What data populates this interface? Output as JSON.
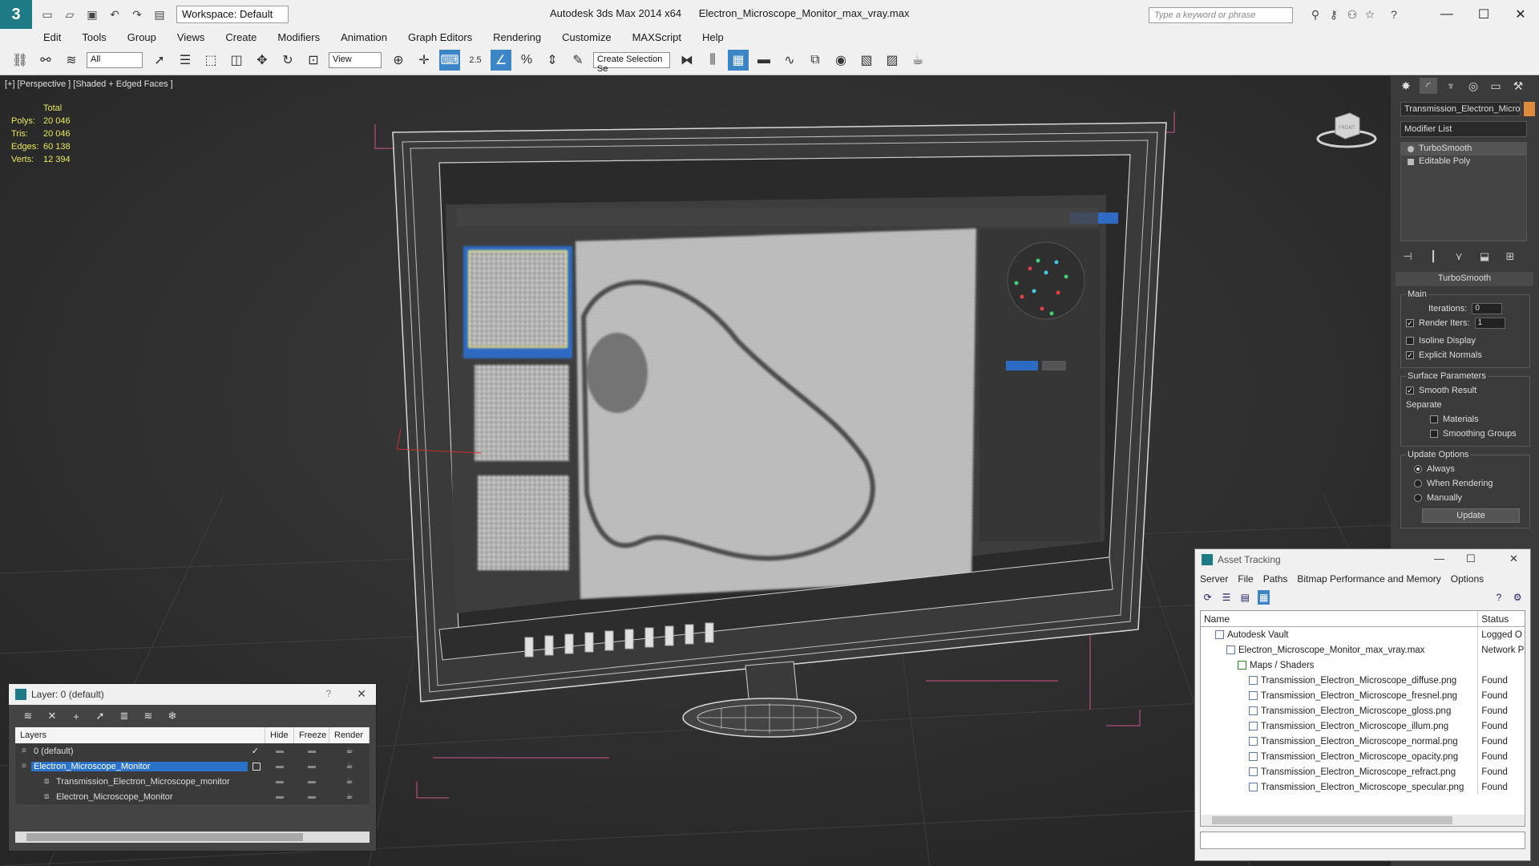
{
  "title_bar": {
    "workspace": "Workspace: Default",
    "app_title": "Autodesk 3ds Max  2014 x64",
    "file_name": "Electron_Microscope_Monitor_max_vray.max",
    "search_placeholder": "Type a keyword or phrase"
  },
  "menu": [
    "Edit",
    "Tools",
    "Group",
    "Views",
    "Create",
    "Modifiers",
    "Animation",
    "Graph Editors",
    "Rendering",
    "Customize",
    "MAXScript",
    "Help"
  ],
  "toolbar": {
    "selection_filter": "All",
    "ref_coord": "View",
    "selection_set": "Create Selection Se",
    "snap_label": "2.5"
  },
  "viewport": {
    "label": "[+] [Perspective ] [Shaded + Edged Faces ]",
    "stats_header": "Total",
    "stats": [
      {
        "k": "Polys:",
        "v": "20 046"
      },
      {
        "k": "Tris:",
        "v": "20 046"
      },
      {
        "k": "Edges:",
        "v": "60 138"
      },
      {
        "k": "Verts:",
        "v": "12 394"
      }
    ],
    "viewcube_label": "FRONT"
  },
  "command_panel": {
    "object_name": "Transmission_Electron_Microscope_monitor",
    "modifier_list": "Modifier List",
    "stack": [
      "TurboSmooth",
      "Editable Poly"
    ],
    "rollout_title": "TurboSmooth",
    "main_group": "Main",
    "iterations_label": "Iterations:",
    "iterations_value": "0",
    "render_iters_label": "Render Iters:",
    "render_iters_value": "1",
    "isoline": "Isoline Display",
    "explicit_normals": "Explicit Normals",
    "surface_group": "Surface Parameters",
    "smooth_result": "Smooth Result",
    "separate": "Separate",
    "materials": "Materials",
    "smoothing_groups": "Smoothing Groups",
    "update_group": "Update Options",
    "always": "Always",
    "when_rendering": "When Rendering",
    "manually": "Manually",
    "update_button": "Update",
    "accent_color": "#e08a3c"
  },
  "layer_dialog": {
    "title": "Layer: 0 (default)",
    "columns": [
      "Layers",
      "Hide",
      "Freeze",
      "Render"
    ],
    "rows": [
      {
        "name": "0 (default)",
        "indent": 0
      },
      {
        "name": "Electron_Microscope_Monitor",
        "indent": 0
      },
      {
        "name": "Transmission_Electron_Microscope_monitor",
        "indent": 1
      },
      {
        "name": "Electron_Microscope_Monitor",
        "indent": 1
      }
    ],
    "selection_color": "#2a72c8"
  },
  "asset_tracking": {
    "title": "Asset Tracking",
    "menu": [
      "Server",
      "File",
      "Paths",
      "Bitmap Performance and Memory",
      "Options"
    ],
    "columns": [
      "Name",
      "Status"
    ],
    "rows": [
      {
        "name": "Autodesk Vault",
        "status": "Logged O",
        "indent": 1
      },
      {
        "name": "Electron_Microscope_Monitor_max_vray.max",
        "status": "Network P",
        "indent": 2
      },
      {
        "name": "Maps / Shaders",
        "status": "",
        "indent": 3
      },
      {
        "name": "Transmission_Electron_Microscope_diffuse.png",
        "status": "Found",
        "indent": 4
      },
      {
        "name": "Transmission_Electron_Microscope_fresnel.png",
        "status": "Found",
        "indent": 4
      },
      {
        "name": "Transmission_Electron_Microscope_gloss.png",
        "status": "Found",
        "indent": 4
      },
      {
        "name": "Transmission_Electron_Microscope_illum.png",
        "status": "Found",
        "indent": 4
      },
      {
        "name": "Transmission_Electron_Microscope_normal.png",
        "status": "Found",
        "indent": 4
      },
      {
        "name": "Transmission_Electron_Microscope_opacity.png",
        "status": "Found",
        "indent": 4
      },
      {
        "name": "Transmission_Electron_Microscope_refract.png",
        "status": "Found",
        "indent": 4
      },
      {
        "name": "Transmission_Electron_Microscope_specular.png",
        "status": "Found",
        "indent": 4
      }
    ]
  }
}
